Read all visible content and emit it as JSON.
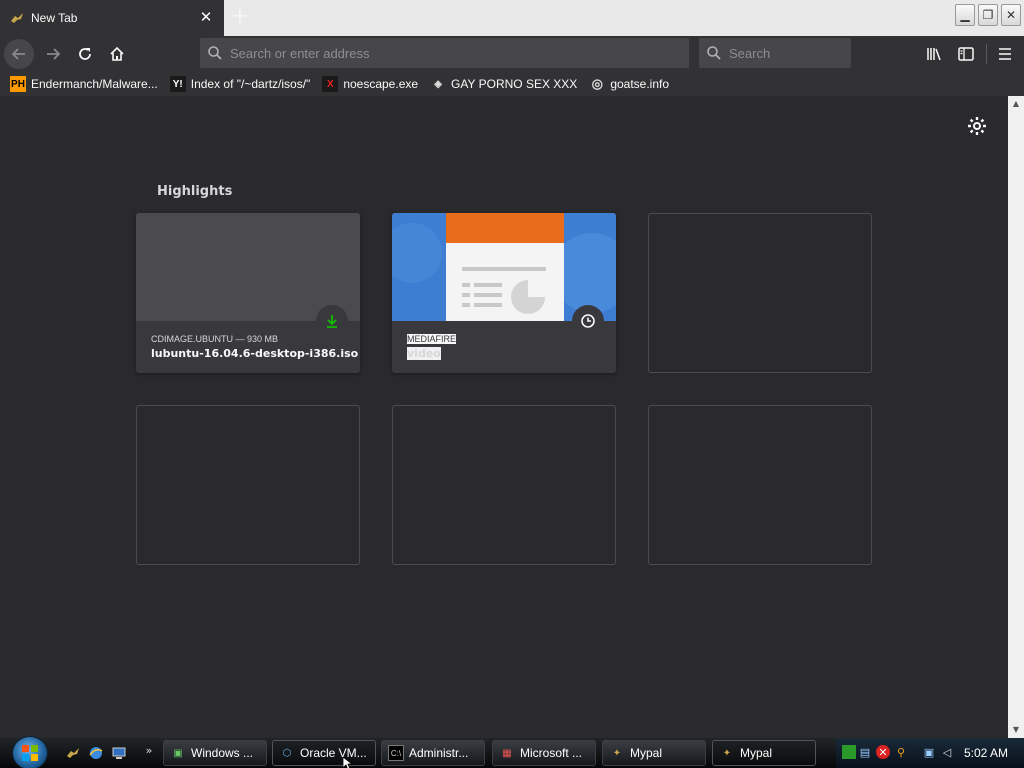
{
  "tab": {
    "title": "New Tab",
    "close": "✕"
  },
  "newtab_symbol": "+",
  "window_controls": {
    "minimize": "▁",
    "restore": "❐",
    "close": "✕"
  },
  "urlbar": {
    "placeholder": "Search or enter address"
  },
  "searchbar": {
    "placeholder": "Search"
  },
  "bookmarks": [
    {
      "icon_text": "PH",
      "label": "Endermanch/Malware..."
    },
    {
      "icon_text": "Y!",
      "label": "Index of \"/~dartz/isos/\""
    },
    {
      "icon_text": "X",
      "label": "noescape.exe"
    },
    {
      "icon_text": "◈",
      "label": "GAY PORNO SEX XXX"
    },
    {
      "icon_text": "◎",
      "label": "goatse.info"
    }
  ],
  "content": {
    "section_title": "Highlights",
    "cards": [
      {
        "host": "CDIMAGE.UBUNTU — 930 MB",
        "title": "lubuntu-16.04.6-desktop-i386.iso",
        "badge": "download-icon"
      },
      {
        "host": "MEDIAFIRE",
        "title": "video",
        "badge": "clock-icon"
      }
    ]
  },
  "taskbar": {
    "buttons": [
      {
        "icon": "▣",
        "label": "Windows ..."
      },
      {
        "icon": "⬡",
        "label": "Oracle VM..."
      },
      {
        "icon": "C:\\",
        "label": "Administr..."
      },
      {
        "icon": "▦",
        "label": "Microsoft ..."
      },
      {
        "icon": "✦",
        "label": "Mypal"
      },
      {
        "icon": "✦",
        "label": "Mypal"
      }
    ],
    "clock": "5:02 AM",
    "quicklaunch_more": "»"
  },
  "colors": {
    "accent_green": "#12bc00",
    "toolbar": "#323234",
    "content_bg": "#2a2a2e"
  }
}
